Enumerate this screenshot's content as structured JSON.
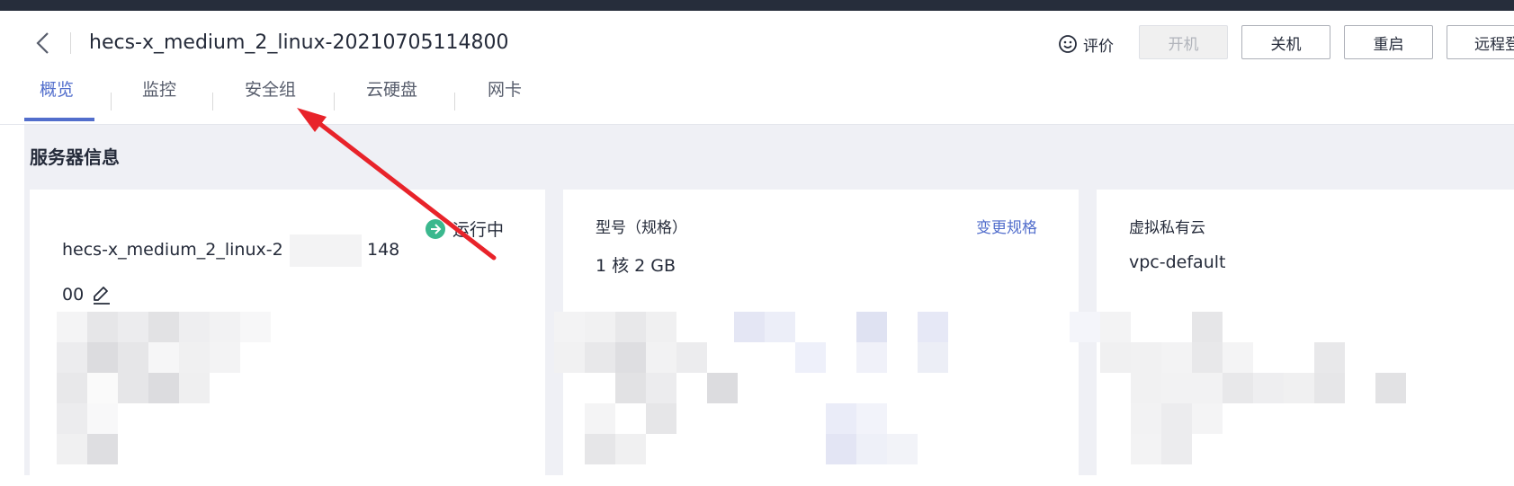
{
  "header": {
    "title": "hecs-x_medium_2_linux-20210705114800",
    "rate_label": "评价",
    "buttons": {
      "start": "开机",
      "stop": "关机",
      "reboot": "重启",
      "remote": "远程登"
    }
  },
  "tabs": [
    {
      "label": "概览",
      "active": true
    },
    {
      "label": "监控"
    },
    {
      "label": "安全组"
    },
    {
      "label": "云硬盘"
    },
    {
      "label": "网卡"
    }
  ],
  "section_title": "服务器信息",
  "server_card": {
    "name_line1": "hecs-x_medium_2_linux-2",
    "name_line1_tail": "148",
    "name_line2": "00",
    "status": "运行中",
    "status_color": "#3bb88e"
  },
  "spec_card": {
    "label": "型号（规格）",
    "action": "变更规格",
    "value": "1 核 2 GB"
  },
  "vpc_card": {
    "label": "虚拟私有云",
    "value": "vpc-default"
  },
  "colors": {
    "accent": "#526ecc",
    "annotation_arrow": "#e8232a",
    "top_bar": "#262d3b"
  }
}
